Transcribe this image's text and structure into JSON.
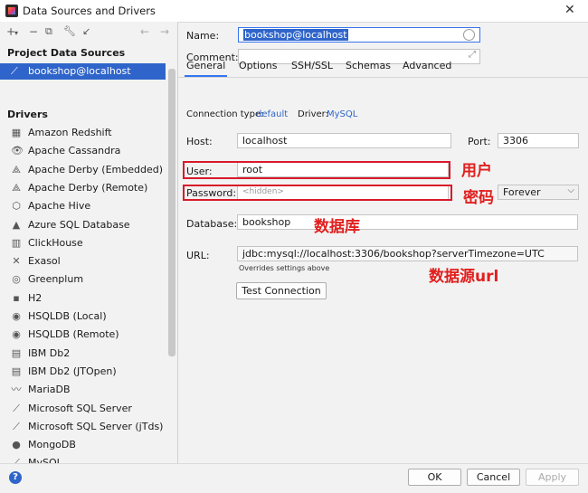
{
  "window": {
    "title": "Data Sources and Drivers"
  },
  "left": {
    "project_header": "Project Data Sources",
    "selected_source": "bookshop@localhost",
    "drivers_header": "Drivers",
    "drivers": [
      {
        "label": "Amazon Redshift",
        "icon": "redshift-icon"
      },
      {
        "label": "Apache Cassandra",
        "icon": "cassandra-icon"
      },
      {
        "label": "Apache Derby (Embedded)",
        "icon": "derby-icon"
      },
      {
        "label": "Apache Derby (Remote)",
        "icon": "derby-icon"
      },
      {
        "label": "Apache Hive",
        "icon": "hive-icon"
      },
      {
        "label": "Azure SQL Database",
        "icon": "azure-icon"
      },
      {
        "label": "ClickHouse",
        "icon": "clickhouse-icon"
      },
      {
        "label": "Exasol",
        "icon": "exasol-icon"
      },
      {
        "label": "Greenplum",
        "icon": "greenplum-icon"
      },
      {
        "label": "H2",
        "icon": "h2-icon"
      },
      {
        "label": "HSQLDB (Local)",
        "icon": "hsqldb-icon"
      },
      {
        "label": "HSQLDB (Remote)",
        "icon": "hsqldb-icon"
      },
      {
        "label": "IBM Db2",
        "icon": "ibm-icon"
      },
      {
        "label": "IBM Db2 (JTOpen)",
        "icon": "ibm-icon"
      },
      {
        "label": "MariaDB",
        "icon": "mariadb-icon"
      },
      {
        "label": "Microsoft SQL Server",
        "icon": "mssql-icon"
      },
      {
        "label": "Microsoft SQL Server (jTds)",
        "icon": "mssql-icon"
      },
      {
        "label": "MongoDB",
        "icon": "mongodb-icon"
      },
      {
        "label": "MySQL",
        "icon": "mysql-icon"
      }
    ]
  },
  "form": {
    "name_label": "Name:",
    "name_value": "bookshop@localhost",
    "comment_label": "Comment:",
    "comment_value": "",
    "tabs": [
      "General",
      "Options",
      "SSH/SSL",
      "Schemas",
      "Advanced"
    ],
    "connection_type_label": "Connection type:",
    "connection_type_value": "default",
    "driver_label": "Driver:",
    "driver_value": "MySQL",
    "host_label": "Host:",
    "host_value": "localhost",
    "port_label": "Port:",
    "port_value": "3306",
    "user_label": "User:",
    "user_value": "root",
    "password_label": "Password:",
    "password_placeholder": "<hidden>",
    "save_value": "Forever",
    "database_label": "Database:",
    "database_value": "bookshop",
    "url_label": "URL:",
    "url_value": "jdbc:mysql://localhost:3306/bookshop?serverTimezone=UTC",
    "url_hint": "Overrides settings above",
    "test_button": "Test Connection"
  },
  "annotations": {
    "user": "用户",
    "password": "密码",
    "database": "数据库",
    "url": "数据源url"
  },
  "buttons": {
    "ok": "OK",
    "cancel": "Cancel",
    "apply": "Apply"
  },
  "colors": {
    "accent": "#2f65ca",
    "annotation": "#d91a2a",
    "tab_underline": "#3574f0"
  }
}
